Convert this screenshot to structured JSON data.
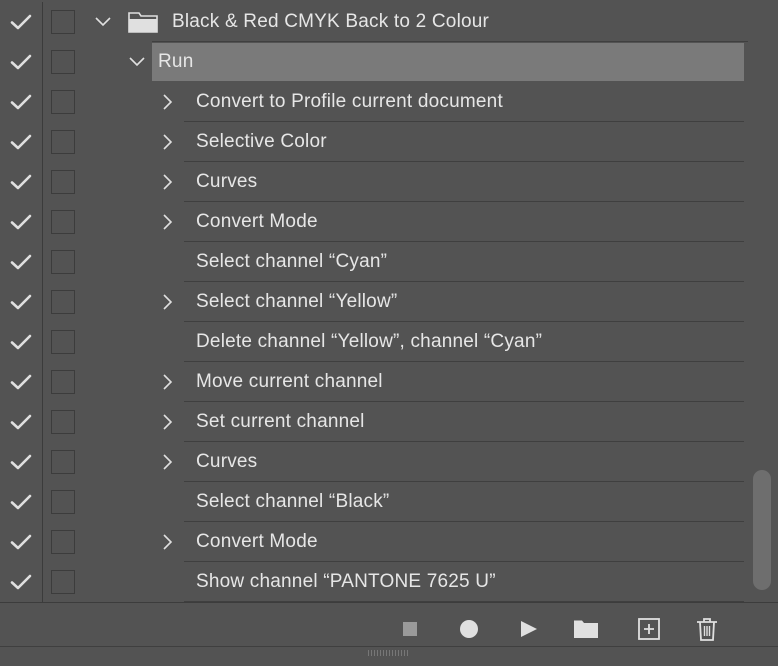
{
  "colors": {
    "background": "#535353",
    "selected_row": "#7a7a7a",
    "text": "#e6e6e6",
    "icon": "#e0e0e0"
  },
  "action_set": {
    "name": "Black & Red CMYK Back to 2 Colour",
    "icon": "folder-icon",
    "expanded": true
  },
  "action": {
    "name": "Run",
    "expanded": true,
    "selected": true
  },
  "steps": [
    {
      "label": "Convert to Profile current document",
      "has_details": true
    },
    {
      "label": "Selective Color",
      "has_details": true
    },
    {
      "label": "Curves",
      "has_details": true
    },
    {
      "label": "Convert Mode",
      "has_details": true
    },
    {
      "label": "Select channel “Cyan”",
      "has_details": false
    },
    {
      "label": "Select channel “Yellow”",
      "has_details": true
    },
    {
      "label": "Delete channel “Yellow”, channel “Cyan”",
      "has_details": false
    },
    {
      "label": "Move current channel",
      "has_details": true
    },
    {
      "label": "Set current channel",
      "has_details": true
    },
    {
      "label": "Curves",
      "has_details": true
    },
    {
      "label": "Select channel “Black”",
      "has_details": false
    },
    {
      "label": "Convert Mode",
      "has_details": true
    },
    {
      "label": "Show channel “PANTONE 7625 U”",
      "has_details": false
    }
  ],
  "toolbar": {
    "buttons": [
      {
        "name": "stop-recording-button",
        "icon": "stop-icon"
      },
      {
        "name": "begin-recording-button",
        "icon": "record-icon"
      },
      {
        "name": "play-selection-button",
        "icon": "play-icon"
      },
      {
        "name": "create-new-set-button",
        "icon": "folder-icon"
      },
      {
        "name": "create-new-action-button",
        "icon": "new-action-icon"
      },
      {
        "name": "delete-button",
        "icon": "trash-icon"
      }
    ]
  }
}
